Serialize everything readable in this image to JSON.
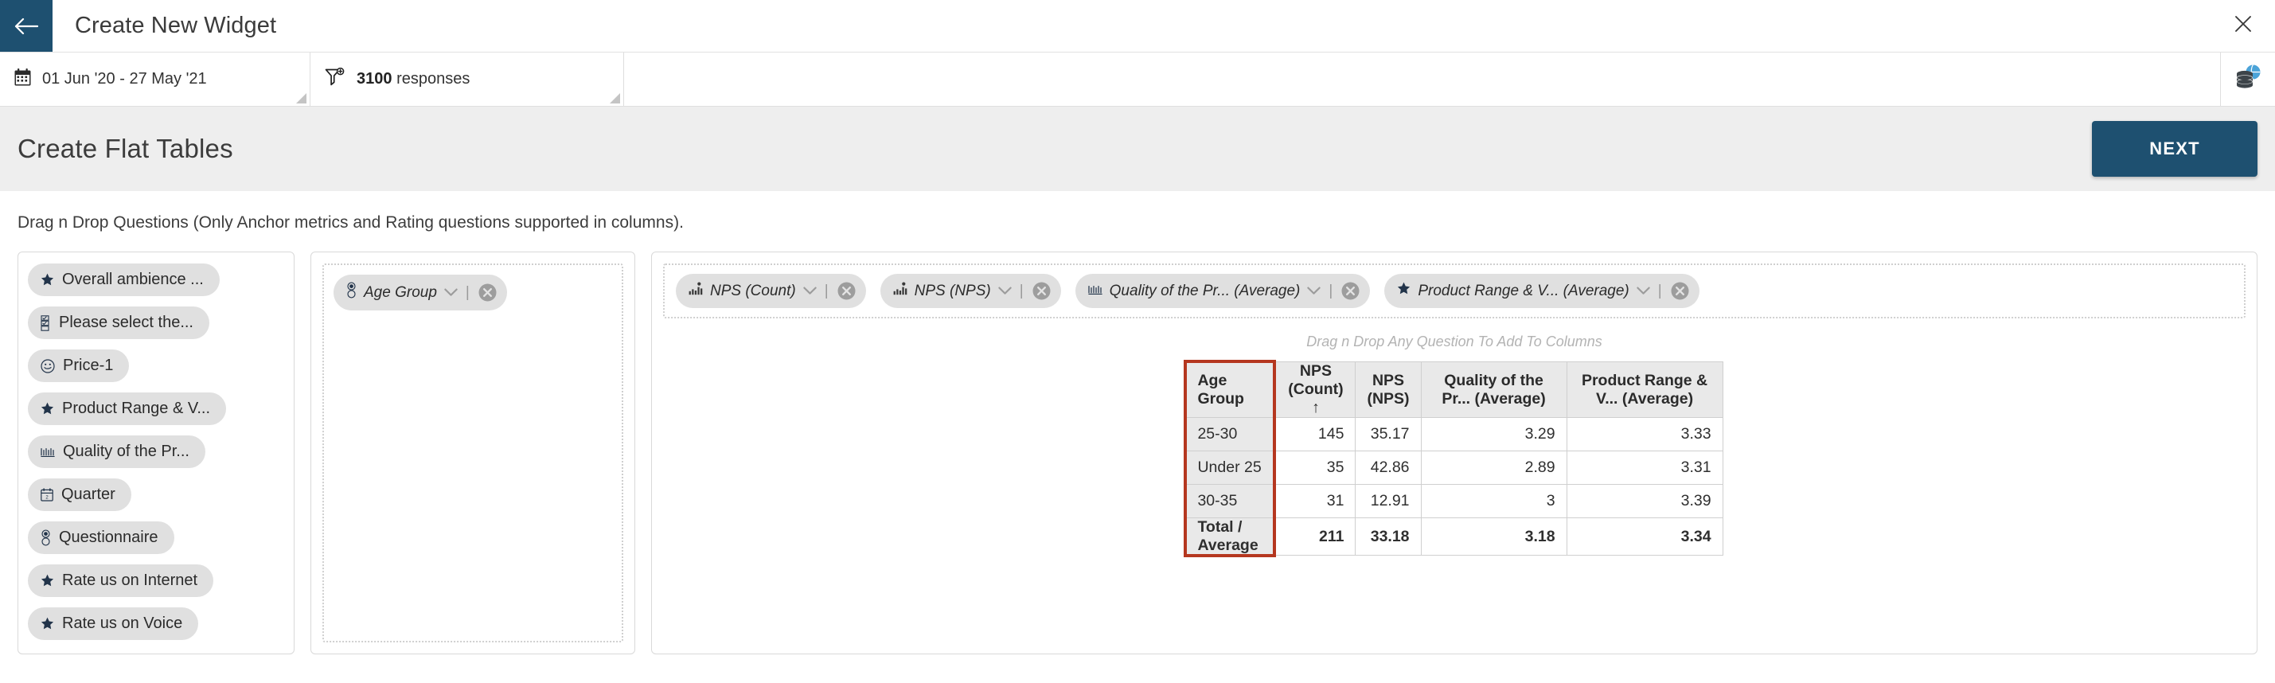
{
  "titlebar": {
    "back_icon": "arrow-left-icon",
    "title": "Create New Widget",
    "close_icon": "close-icon"
  },
  "contextbar": {
    "date_icon": "calendar-icon",
    "date_range": "01 Jun '20 - 27 May '21",
    "filter_icon": "filter-plus-icon",
    "response_count": "3100",
    "response_label": "responses",
    "datasource_icon": "database-globe-icon"
  },
  "pagehead": {
    "title": "Create Flat Tables",
    "next_label": "NEXT",
    "accent_color": "#1e5070"
  },
  "instruction": "Drag n Drop Questions (Only Anchor metrics and Rating questions supported in columns).",
  "palette": {
    "items": [
      {
        "label": "Overall ambience ...",
        "icon": "star-icon"
      },
      {
        "label": "Please select the...",
        "icon": "checklist-icon"
      },
      {
        "label": "Price-1",
        "icon": "smiley-icon"
      },
      {
        "label": "Product Range & V...",
        "icon": "star-icon"
      },
      {
        "label": "Quality of the Pr...",
        "icon": "scale-icon"
      },
      {
        "label": "Quarter",
        "icon": "calendar-small-icon"
      },
      {
        "label": "Questionnaire",
        "icon": "radio-icon"
      },
      {
        "label": "Rate us on Internet",
        "icon": "star-icon"
      },
      {
        "label": "Rate us on Voice",
        "icon": "star-icon"
      }
    ]
  },
  "rows_zone": {
    "chips": [
      {
        "label": "Age Group",
        "icon": "radio-icon",
        "caret": "chevron-down-icon",
        "remove": "remove-circle-icon"
      }
    ]
  },
  "columns_zone": {
    "chips": [
      {
        "label": "NPS (Count)",
        "icon": "metric-bars-icon",
        "caret": "chevron-down-icon",
        "remove": "remove-circle-icon"
      },
      {
        "label": "NPS (NPS)",
        "icon": "metric-bars-icon",
        "caret": "chevron-down-icon",
        "remove": "remove-circle-icon"
      },
      {
        "label": "Quality of the Pr... (Average)",
        "icon": "scale-icon",
        "caret": "chevron-down-icon",
        "remove": "remove-circle-icon"
      },
      {
        "label": "Product Range & V... (Average)",
        "icon": "star-icon",
        "caret": "chevron-down-icon",
        "remove": "remove-circle-icon"
      }
    ],
    "drop_hint": "Drag n Drop Any Question To Add To Columns"
  },
  "preview_table": {
    "headers": [
      "Age Group",
      "NPS (Count) ↑",
      "NPS (NPS)",
      "Quality of the Pr... (Average)",
      "Product Range & V... (Average)"
    ],
    "rows": [
      {
        "cells": [
          "25-30",
          "145",
          "35.17",
          "3.29",
          "3.33"
        ],
        "total": false
      },
      {
        "cells": [
          "Under 25",
          "35",
          "42.86",
          "2.89",
          "3.31"
        ],
        "total": false
      },
      {
        "cells": [
          "30-35",
          "31",
          "12.91",
          "3",
          "3.39"
        ],
        "total": false
      },
      {
        "cells": [
          "Total / Average",
          "211",
          "33.18",
          "3.18",
          "3.34"
        ],
        "total": true
      }
    ],
    "highlight_color": "#b5371f",
    "sort_column": "NPS (Count)",
    "sort_direction": "ascending"
  }
}
